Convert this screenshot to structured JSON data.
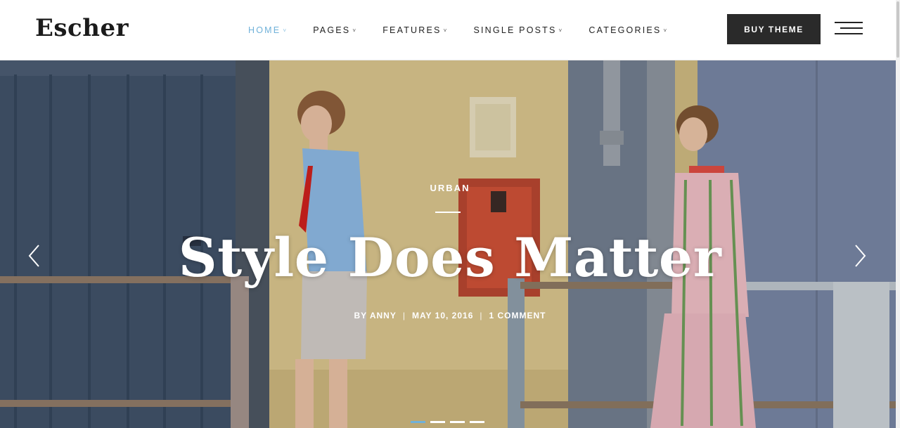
{
  "header": {
    "logo": "Escher",
    "nav": [
      {
        "label": "HOME",
        "active": true
      },
      {
        "label": "PAGES",
        "active": false
      },
      {
        "label": "FEATURES",
        "active": false
      },
      {
        "label": "SINGLE POSTS",
        "active": false
      },
      {
        "label": "CATEGORIES",
        "active": false
      }
    ],
    "chevron": "˅",
    "buy_button": "BUY THEME",
    "menu_icon": "hamburger-icon"
  },
  "hero": {
    "category": "URBAN",
    "title": "Style Does Matter",
    "meta": {
      "author": "BY ANNY",
      "date": "MAY 10, 2016",
      "comments": "1 COMMENT",
      "separator": "|"
    },
    "prev_icon": "chevron-left-icon",
    "next_icon": "chevron-right-icon",
    "slides_count": 4,
    "active_slide": 1
  },
  "colors": {
    "accent": "#6fb1d9",
    "button_bg": "#2a2a2a",
    "text_dark": "#1b1b1b"
  }
}
